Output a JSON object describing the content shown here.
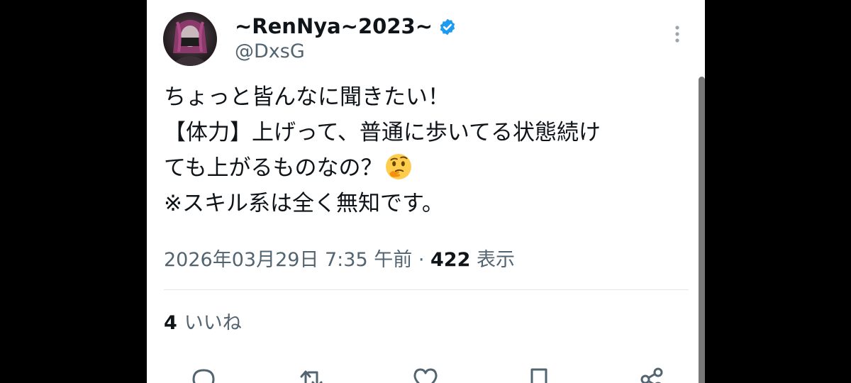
{
  "user": {
    "display_name": "~RenNya~2023~",
    "handle": "@DxsG",
    "verified": true
  },
  "tweet": {
    "lines": [
      "ちょっと皆んなに聞きたい！",
      "【体力】上げって、普通に歩いてる状態続け",
      "ても上がるものなの？",
      "※スキル系は全く無知です。"
    ],
    "emoji": "thinking-face"
  },
  "meta": {
    "date": "2026年03月29日 7:35 午前",
    "separator": "·",
    "views_count": "422",
    "views_label": "表示"
  },
  "engagement": {
    "likes_count": "4",
    "likes_label": "いいね"
  },
  "actions": [
    "reply-icon",
    "retweet-icon",
    "like-icon",
    "bookmark-icon",
    "share-icon"
  ],
  "colors": {
    "text": "#0f1419",
    "secondary": "#536471",
    "verified": "#1d9bf0"
  }
}
